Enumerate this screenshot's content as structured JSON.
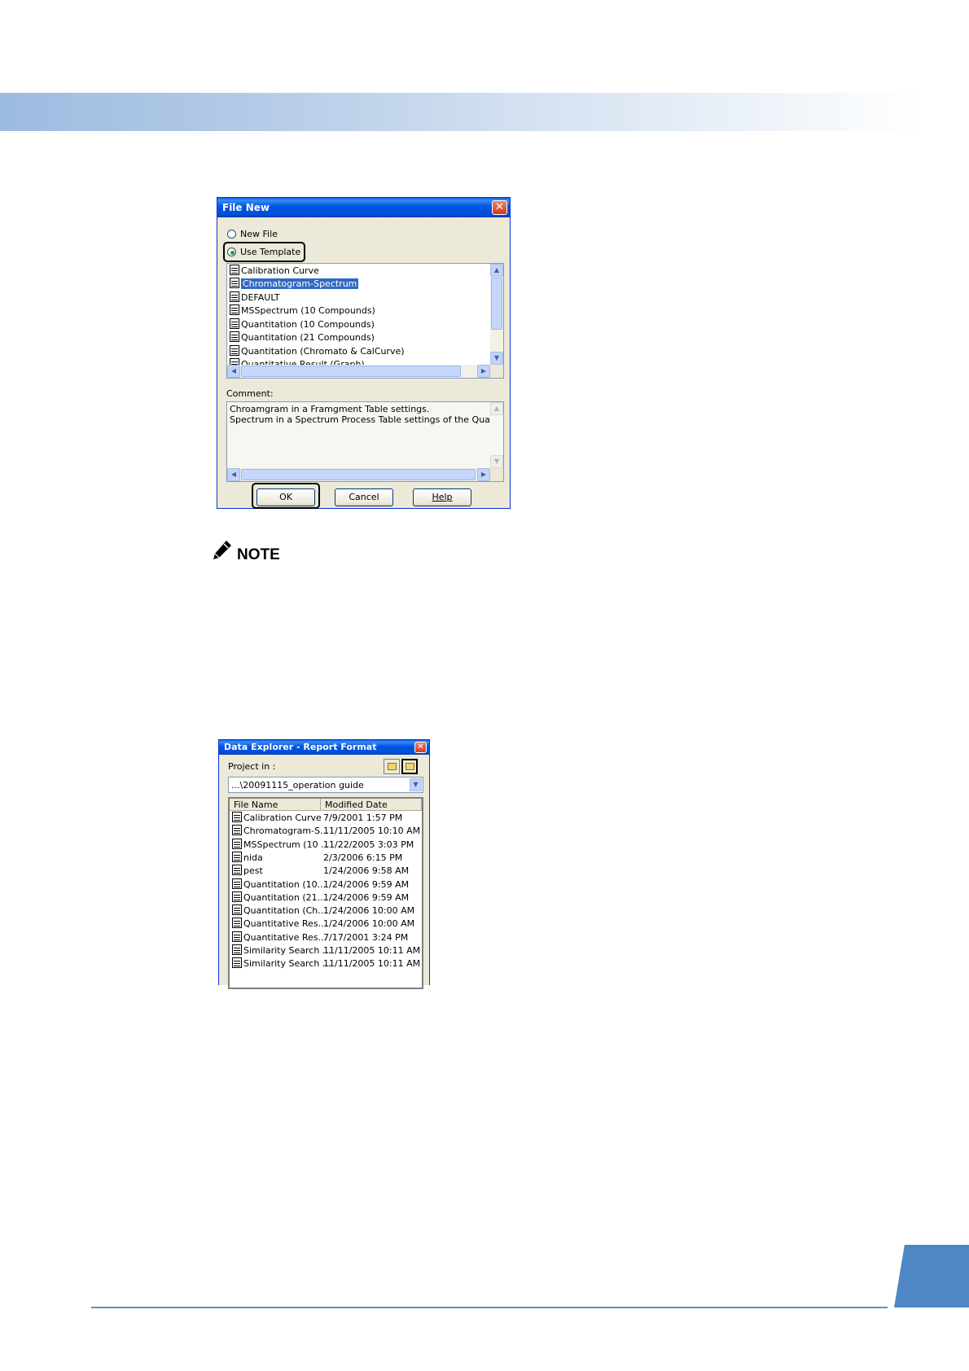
{
  "file_new_dialog": {
    "title": "File New",
    "radio_new_file": "New File",
    "radio_use_template": "Use Template",
    "templates": [
      "Calibration Curve",
      "Chromatogram-Spectrum",
      "DEFAULT",
      "MSSpectrum (10 Compounds)",
      "Quantitation (10 Compounds)",
      "Quantitation (21 Compounds)",
      "Quantitation (Chromato & CalCurve)",
      "Quantitative Result (Graph)"
    ],
    "selected_template": "Chromatogram-Spectrum",
    "comment_label": "Comment:",
    "comment_lines": [
      "Chroamgram in a Framgment Table settings.",
      "Spectrum in a Spectrum Process Table settings of the Qualtative Tabl"
    ],
    "ok_label": "OK",
    "cancel_label": "Cancel",
    "help_label": "Help"
  },
  "note": {
    "label": "NOTE"
  },
  "data_explorer": {
    "title": "Data Explorer - Report Format",
    "project_label": "Project in :",
    "project_path": "...\\20091115_operation guide",
    "columns": [
      "File Name",
      "Modified Date"
    ],
    "rows": [
      [
        "Calibration Curve",
        "7/9/2001 1:57 PM"
      ],
      [
        "Chromatogram-S...",
        "11/11/2005 10:10 AM"
      ],
      [
        "MSSpectrum (10 ...",
        "11/22/2005 3:03 PM"
      ],
      [
        "nida",
        "2/3/2006 6:15 PM"
      ],
      [
        "pest",
        "1/24/2006 9:58 AM"
      ],
      [
        "Quantitation (10...",
        "1/24/2006 9:59 AM"
      ],
      [
        "Quantitation (21...",
        "1/24/2006 9:59 AM"
      ],
      [
        "Quantitation (Ch...",
        "1/24/2006 10:00 AM"
      ],
      [
        "Quantitative Res...",
        "1/24/2006 10:00 AM"
      ],
      [
        "Quantitative Res...",
        "7/17/2001 3:24 PM"
      ],
      [
        "Similarity Search ...",
        "11/11/2005 10:11 AM"
      ],
      [
        "Similarity Search ...",
        "11/11/2005 10:11 AM"
      ]
    ]
  }
}
